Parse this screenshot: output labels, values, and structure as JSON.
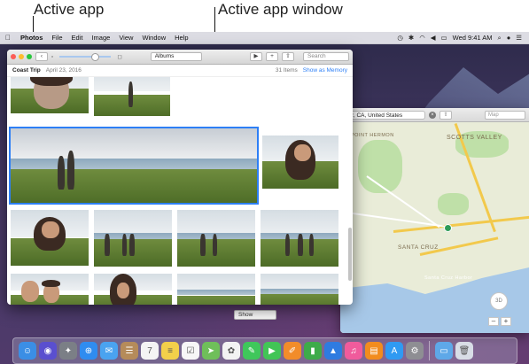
{
  "annotations": {
    "active_app": "Active app",
    "active_app_window": "Active app window"
  },
  "menubar": {
    "apple_icon": "apple-icon",
    "app_name": "Photos",
    "items": [
      "File",
      "Edit",
      "Image",
      "View",
      "Window",
      "Help"
    ],
    "clock": "Wed 9:41 AM",
    "status_icons": [
      "time-machine-icon",
      "bluetooth-icon",
      "wifi-icon",
      "volume-icon",
      "battery-icon",
      "spotlight-icon",
      "user-icon",
      "list-icon"
    ]
  },
  "photos_window": {
    "albums_select": "Albums",
    "search_placeholder": "Search",
    "album_title": "Coast Trip",
    "album_date": "April 23, 2016",
    "item_count": "31 Items",
    "show_as_memory": "Show as Memory",
    "toolbar_icons": [
      "back-icon",
      "play-icon",
      "add-icon",
      "share-icon"
    ]
  },
  "maps_window": {
    "search_value": "uz, CA, United States",
    "view_select": "Map",
    "show_select": "Show",
    "view_3d": "3D",
    "zoom_out": "–",
    "zoom_in": "+",
    "labels": [
      "POINT HERMON",
      "SCOTTS VALLEY",
      "SANTA CRUZ",
      "Santa Cruz Harbor"
    ]
  },
  "dock": {
    "apps": [
      {
        "name": "finder",
        "color": "#3b8ee5",
        "glyph": "☺"
      },
      {
        "name": "siri",
        "color": "#5a4fcf",
        "glyph": "◉"
      },
      {
        "name": "launchpad",
        "color": "#7b7f86",
        "glyph": "✦"
      },
      {
        "name": "safari",
        "color": "#2f8cf0",
        "glyph": "⊕"
      },
      {
        "name": "mail",
        "color": "#4aa3f0",
        "glyph": "✉"
      },
      {
        "name": "contacts",
        "color": "#b58b5a",
        "glyph": "☰"
      },
      {
        "name": "calendar",
        "color": "#f4f4f4",
        "glyph": "7"
      },
      {
        "name": "notes",
        "color": "#f2d04a",
        "glyph": "≡"
      },
      {
        "name": "reminders",
        "color": "#f7f7f7",
        "glyph": "☑"
      },
      {
        "name": "maps",
        "color": "#6fbf5a",
        "glyph": "➤"
      },
      {
        "name": "photos",
        "color": "#f3f3f3",
        "glyph": "✿"
      },
      {
        "name": "messages",
        "color": "#3fc75b",
        "glyph": "✎"
      },
      {
        "name": "facetime",
        "color": "#42c556",
        "glyph": "▶"
      },
      {
        "name": "pages",
        "color": "#f28c2a",
        "glyph": "✐"
      },
      {
        "name": "numbers",
        "color": "#3eab4a",
        "glyph": "▮"
      },
      {
        "name": "keynote",
        "color": "#2f7be0",
        "glyph": "▲"
      },
      {
        "name": "itunes",
        "color": "#f05b9c",
        "glyph": "♫"
      },
      {
        "name": "ibooks",
        "color": "#f28c1e",
        "glyph": "▤"
      },
      {
        "name": "app-store",
        "color": "#2f9af2",
        "glyph": "A"
      },
      {
        "name": "system-preferences",
        "color": "#8e8e93",
        "glyph": "⚙"
      }
    ],
    "trailing": [
      {
        "name": "downloads-folder",
        "color": "#5ea8e8",
        "glyph": "▭"
      },
      {
        "name": "trash",
        "color": "#d8dde6",
        "glyph": "🗑"
      }
    ]
  }
}
